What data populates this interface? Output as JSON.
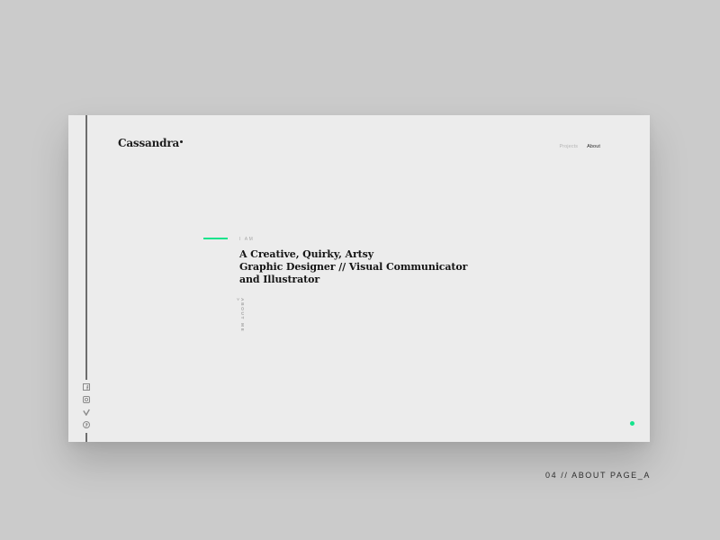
{
  "brand": {
    "logo_text": "Cassandra"
  },
  "nav": {
    "items": [
      {
        "label": "Projects",
        "active": false
      },
      {
        "label": "About",
        "active": true
      }
    ]
  },
  "hero": {
    "eyebrow": "I AM",
    "headline_lines": [
      "A Creative, Quirky, Artsy",
      "Graphic Designer // Visual Communicator",
      "and Illustrator"
    ],
    "about_link": "ABOUT ME >"
  },
  "social": [
    {
      "icon": "facebook-icon"
    },
    {
      "icon": "instagram-icon"
    },
    {
      "icon": "vimeo-icon"
    },
    {
      "icon": "pinterest-icon"
    }
  ],
  "caption": "04 // ABOUT PAGE_A",
  "colors": {
    "accent": "#14e38c",
    "background": "#cbcbcb",
    "card": "#ececec",
    "text_dark": "#141414",
    "text_muted": "#a8a8a8"
  }
}
